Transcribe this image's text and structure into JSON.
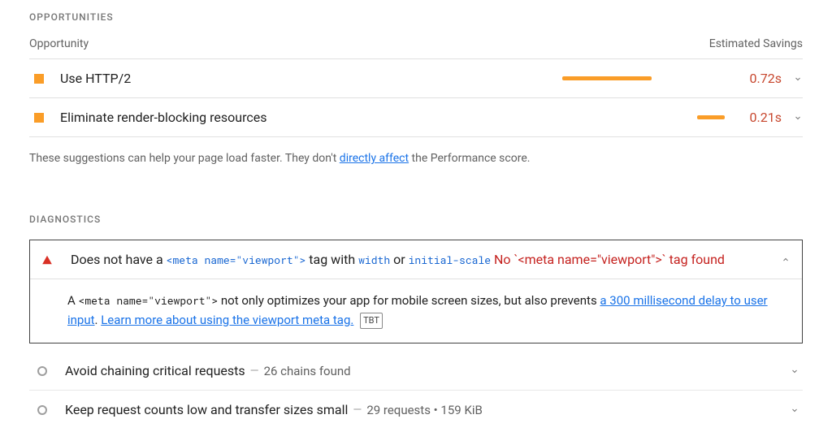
{
  "opportunities": {
    "heading": "OPPORTUNITIES",
    "col_left": "Opportunity",
    "col_right": "Estimated Savings",
    "items": [
      {
        "title": "Use HTTP/2",
        "savings": "0.72s",
        "bar_pct": 55
      },
      {
        "title": "Eliminate render-blocking resources",
        "savings": "0.21s",
        "bar_pct": 17
      }
    ],
    "footnote_pre": "These suggestions can help your page load faster. They don't ",
    "footnote_link": "directly affect",
    "footnote_post": " the Performance score."
  },
  "diagnostics": {
    "heading": "DIAGNOSTICS",
    "expanded": {
      "title_pre": "Does not have a ",
      "code1": "<meta name=\"viewport\">",
      "title_mid1": " tag with ",
      "code2": "width",
      "title_mid2": " or ",
      "code3": "initial-scale",
      "warn": " No `<meta name=\"viewport\">` tag found",
      "body_pre": "A ",
      "body_code": "<meta name=\"viewport\">",
      "body_mid": " not only optimizes your app for mobile screen sizes, but also prevents ",
      "body_link1": "a 300 millisecond delay to user input",
      "body_sep": ". ",
      "body_link2": "Learn more about using the viewport meta tag.",
      "badge": "TBT"
    },
    "rows": [
      {
        "title": "Avoid chaining critical requests",
        "sub": "26 chains found"
      },
      {
        "title": "Keep request counts low and transfer sizes small",
        "sub": "29 requests • 159 KiB"
      }
    ]
  }
}
